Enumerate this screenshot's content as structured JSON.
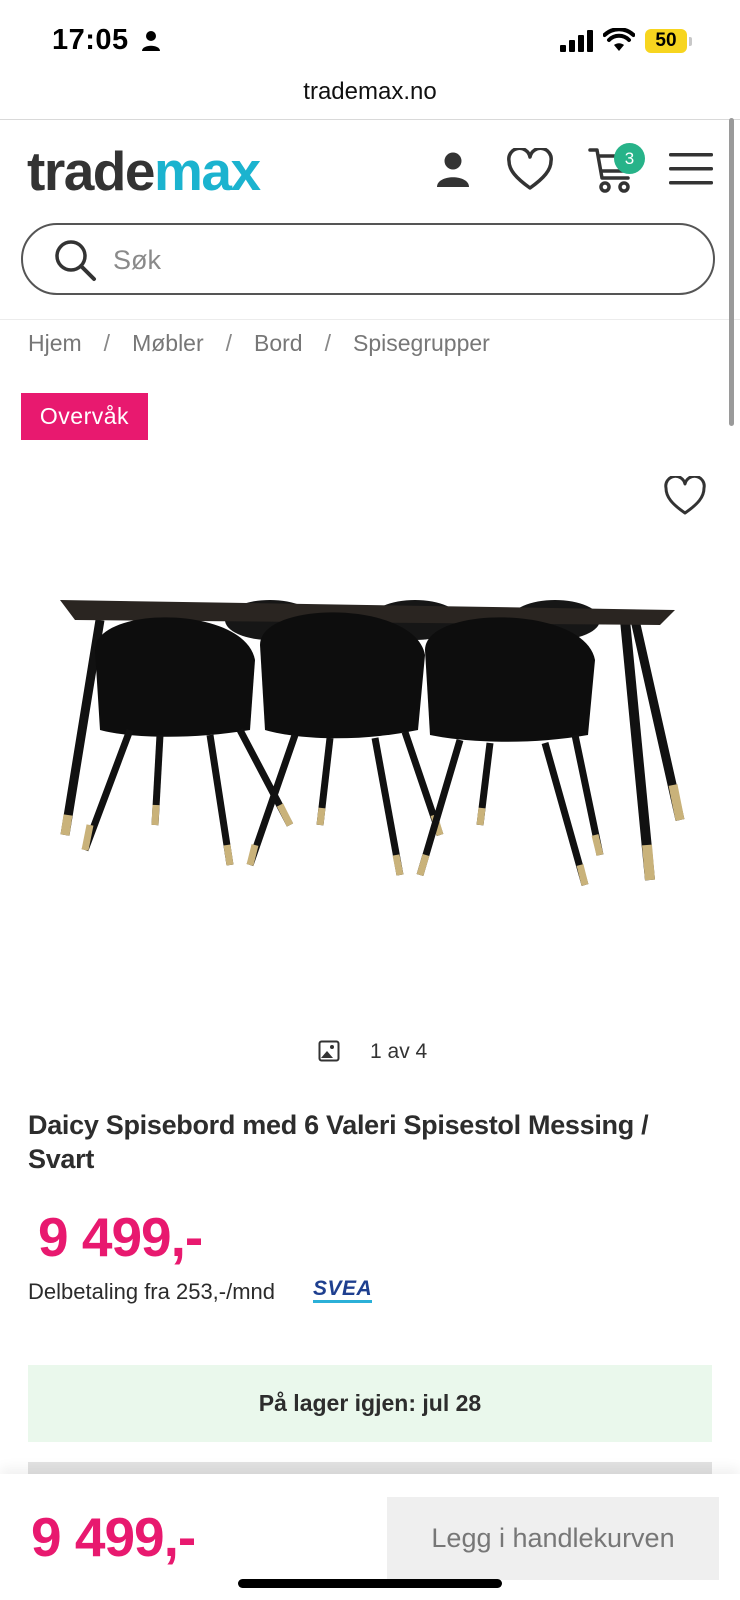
{
  "status_bar": {
    "time": "17:05",
    "battery": "50"
  },
  "browser": {
    "url": "trademax.no"
  },
  "header": {
    "logo_part1": "trade",
    "logo_part2": "max",
    "cart_count": "3"
  },
  "search": {
    "placeholder": "Søk",
    "value": ""
  },
  "breadcrumb": [
    "Hjem",
    "Møbler",
    "Bord",
    "Spisegrupper"
  ],
  "watch_button": "Overvåk",
  "gallery": {
    "counter": "1 av 4"
  },
  "product": {
    "title": "Daicy Spisebord med 6 Valeri Spisestol Messing / Svart",
    "price": "9 499,-",
    "installment": "Delbetaling fra 253,-/mnd",
    "financing_logo": "SVEA",
    "stock_status": "På lager igjen: jul 28"
  },
  "bottom_bar": {
    "price": "9 499,-",
    "add_to_cart": "Legg i handlekurven"
  },
  "colors": {
    "accent": "#e8196f",
    "logo_blue": "#1bb3cf",
    "badge_green": "#27b389",
    "stock_bg": "#eaf8ec"
  },
  "icons": [
    "person-icon",
    "signal-icon",
    "wifi-icon",
    "account-icon",
    "heart-icon",
    "cart-icon",
    "menu-icon",
    "search-icon",
    "image-icon"
  ]
}
